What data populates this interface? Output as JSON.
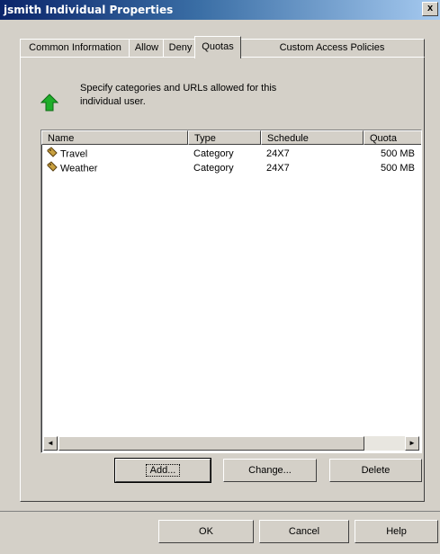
{
  "window": {
    "title": "jsmith Individual Properties",
    "close_glyph": "x"
  },
  "tabs": [
    {
      "label": "Common Information",
      "active": false
    },
    {
      "label": "Allow",
      "active": false
    },
    {
      "label": "Deny",
      "active": false
    },
    {
      "label": "Quotas",
      "active": true
    },
    {
      "label": "Custom Access Policies",
      "active": false
    }
  ],
  "info": {
    "icon": "green-up-arrow-icon",
    "text": "Specify categories and URLs allowed for this individual user."
  },
  "list": {
    "columns": [
      "Name",
      "Type",
      "Schedule",
      "Quota"
    ],
    "rows": [
      {
        "name": "Travel",
        "type": "Category",
        "schedule": "24X7",
        "quota": "500 MB",
        "icon": "category-tag-icon"
      },
      {
        "name": "Weather",
        "type": "Category",
        "schedule": "24X7",
        "quota": "500 MB",
        "icon": "category-tag-icon"
      }
    ],
    "scroll_left_glyph": "◄",
    "scroll_right_glyph": "►"
  },
  "actions": {
    "add": "Add...",
    "change": "Change...",
    "delete": "Delete"
  },
  "dialog_buttons": {
    "ok": "OK",
    "cancel": "Cancel",
    "help": "Help"
  },
  "colors": {
    "face": "#d4d0c8",
    "title_start": "#0a246a",
    "title_end": "#a6caf0",
    "arrow_green": "#1fae2a"
  }
}
